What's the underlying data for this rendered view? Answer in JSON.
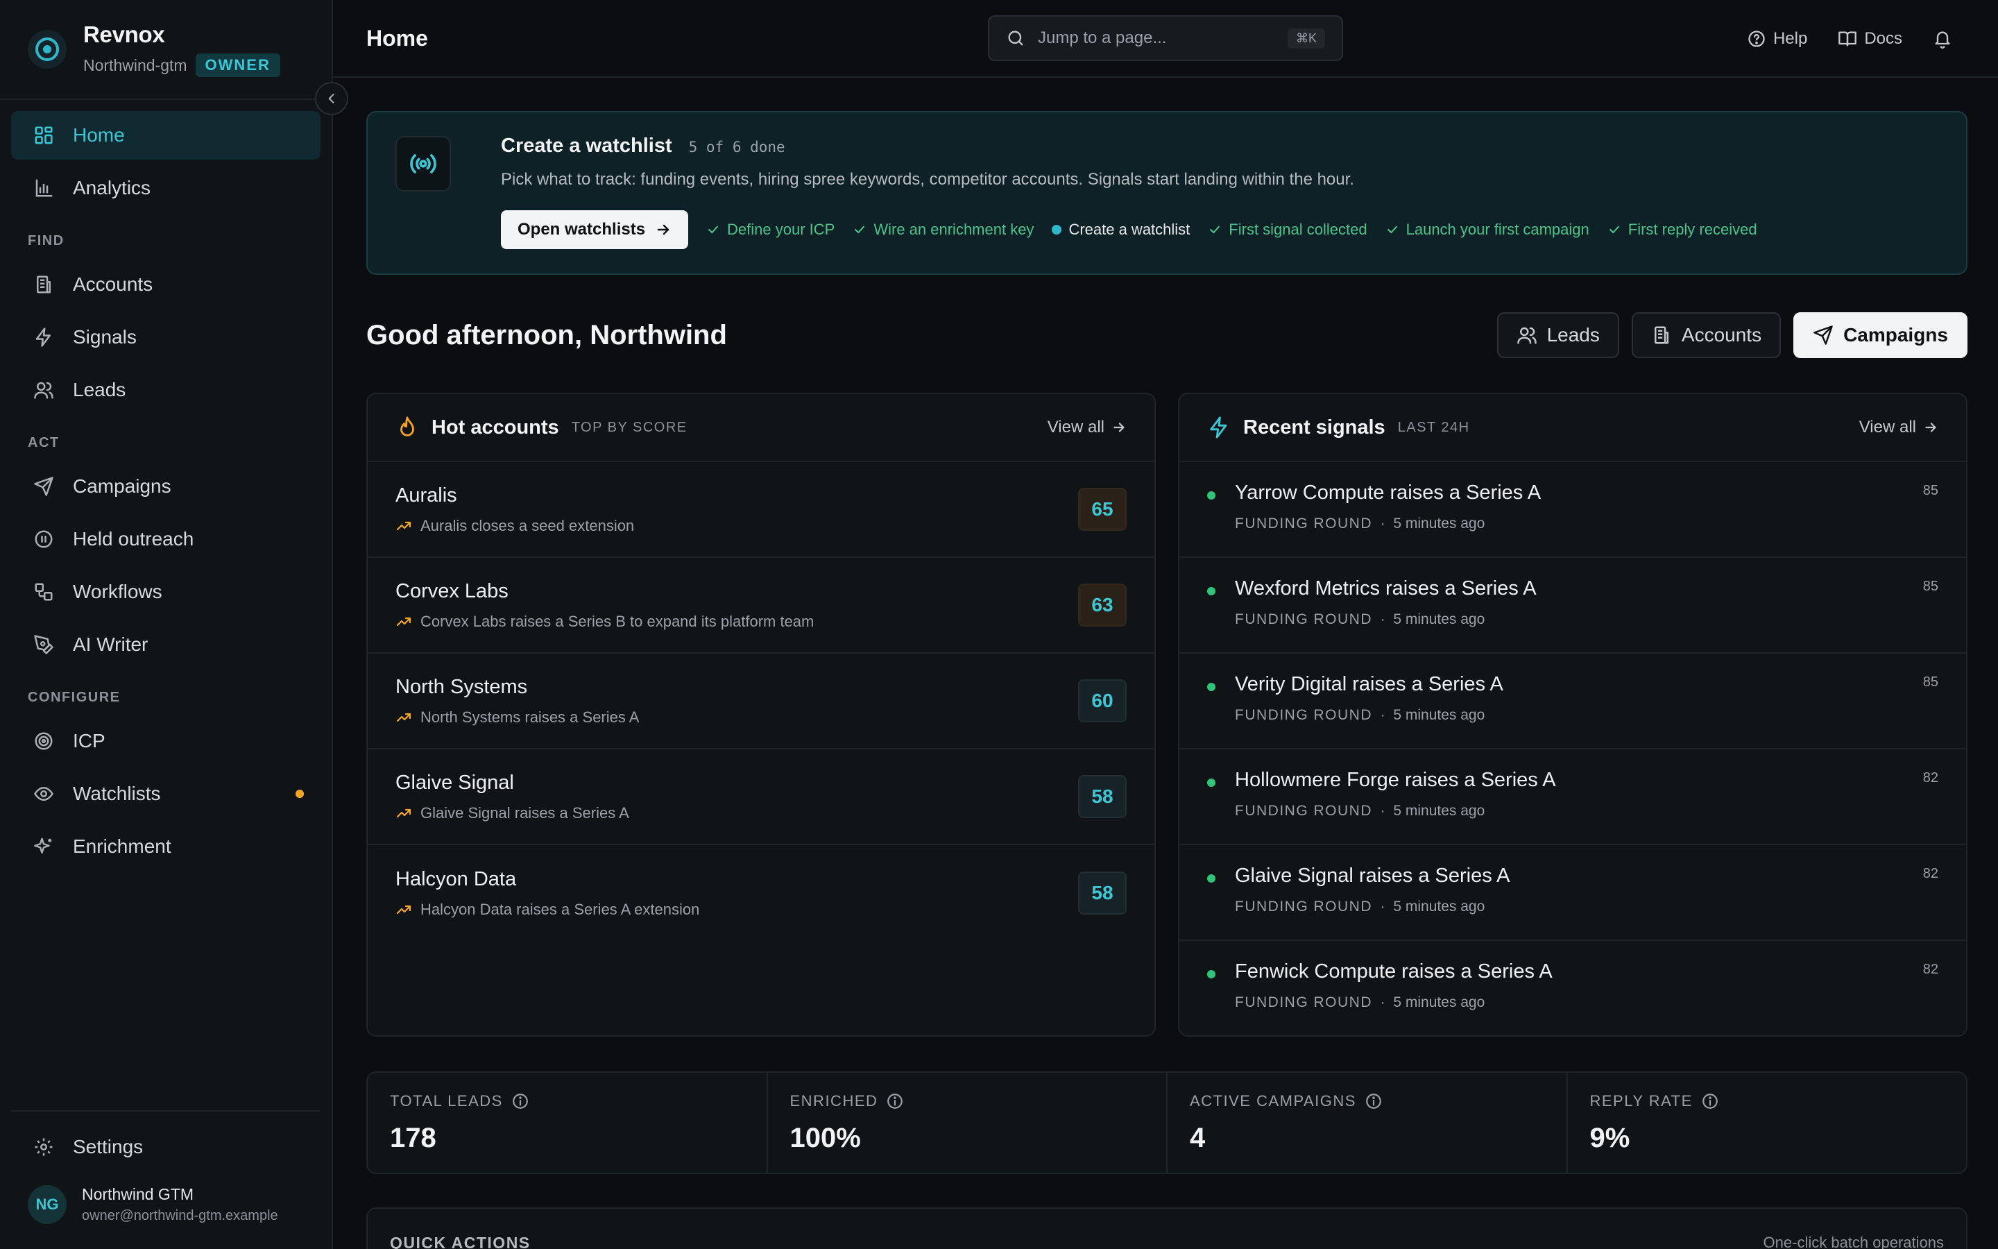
{
  "brand": {
    "name": "Revnox",
    "org": "Northwind-gtm",
    "role": "OWNER"
  },
  "nav": {
    "primary": [
      {
        "label": "Home",
        "icon": "grid-icon",
        "active": true
      },
      {
        "label": "Analytics",
        "icon": "bar-chart-icon"
      }
    ],
    "sections": [
      {
        "title": "FIND",
        "items": [
          {
            "label": "Accounts"
          },
          {
            "label": "Signals"
          },
          {
            "label": "Leads"
          }
        ]
      },
      {
        "title": "ACT",
        "items": [
          {
            "label": "Campaigns"
          },
          {
            "label": "Held outreach"
          },
          {
            "label": "Workflows"
          },
          {
            "label": "AI Writer"
          }
        ]
      },
      {
        "title": "CONFIGURE",
        "items": [
          {
            "label": "ICP"
          },
          {
            "label": "Watchlists"
          },
          {
            "label": "Enrichment"
          }
        ]
      }
    ],
    "settings": "Settings"
  },
  "user": {
    "initials": "NG",
    "name": "Northwind GTM",
    "email": "owner@northwind-gtm.example"
  },
  "topbar": {
    "title": "Home",
    "search_placeholder": "Jump to a page...",
    "shortcut": "⌘K",
    "help": "Help",
    "docs": "Docs"
  },
  "banner": {
    "title": "Create a watchlist",
    "progress": "5 of 6 done",
    "description": "Pick what to track: funding events, hiring spree keywords, competitor accounts. Signals start landing within the hour.",
    "button": "Open watchlists",
    "steps": [
      {
        "label": "Define your ICP",
        "state": "done"
      },
      {
        "label": "Wire an enrichment key",
        "state": "done"
      },
      {
        "label": "Create a watchlist",
        "state": "current"
      },
      {
        "label": "First signal collected",
        "state": "done"
      },
      {
        "label": "Launch your first campaign",
        "state": "done"
      },
      {
        "label": "First reply received",
        "state": "done"
      }
    ]
  },
  "greeting": "Good afternoon, Northwind",
  "quick_buttons": {
    "leads": "Leads",
    "accounts": "Accounts",
    "campaigns": "Campaigns"
  },
  "hot_accounts": {
    "title": "Hot accounts",
    "tag": "TOP BY SCORE",
    "view_all": "View all",
    "rows": [
      {
        "name": "Auralis",
        "sub": "Auralis closes a seed extension",
        "score": "65"
      },
      {
        "name": "Corvex Labs",
        "sub": "Corvex Labs raises a Series B to expand its platform team",
        "score": "63"
      },
      {
        "name": "North Systems",
        "sub": "North Systems raises a Series A",
        "score": "60"
      },
      {
        "name": "Glaive Signal",
        "sub": "Glaive Signal raises a Series A",
        "score": "58"
      },
      {
        "name": "Halcyon Data",
        "sub": "Halcyon Data raises a Series A extension",
        "score": "58"
      }
    ]
  },
  "recent_signals": {
    "title": "Recent signals",
    "tag": "LAST 24H",
    "view_all": "View all",
    "rows": [
      {
        "title": "Yarrow Compute raises a Series A",
        "type": "FUNDING ROUND",
        "time": "5 minutes ago",
        "score": "85"
      },
      {
        "title": "Wexford Metrics raises a Series A",
        "type": "FUNDING ROUND",
        "time": "5 minutes ago",
        "score": "85"
      },
      {
        "title": "Verity Digital raises a Series A",
        "type": "FUNDING ROUND",
        "time": "5 minutes ago",
        "score": "85"
      },
      {
        "title": "Hollowmere Forge raises a Series A",
        "type": "FUNDING ROUND",
        "time": "5 minutes ago",
        "score": "82"
      },
      {
        "title": "Glaive Signal raises a Series A",
        "type": "FUNDING ROUND",
        "time": "5 minutes ago",
        "score": "82"
      },
      {
        "title": "Fenwick Compute raises a Series A",
        "type": "FUNDING ROUND",
        "time": "5 minutes ago",
        "score": "82"
      }
    ]
  },
  "stats": [
    {
      "label": "TOTAL LEADS",
      "value": "178"
    },
    {
      "label": "ENRICHED",
      "value": "100%"
    },
    {
      "label": "ACTIVE CAMPAIGNS",
      "value": "4"
    },
    {
      "label": "REPLY RATE",
      "value": "9%"
    }
  ],
  "quick_actions": {
    "title": "QUICK ACTIONS",
    "subtitle": "One-click batch operations"
  },
  "colors": {
    "accent": "#3cc7d6",
    "success": "#4cc38a",
    "warning": "#f5a623",
    "background": "#0b0d10"
  }
}
